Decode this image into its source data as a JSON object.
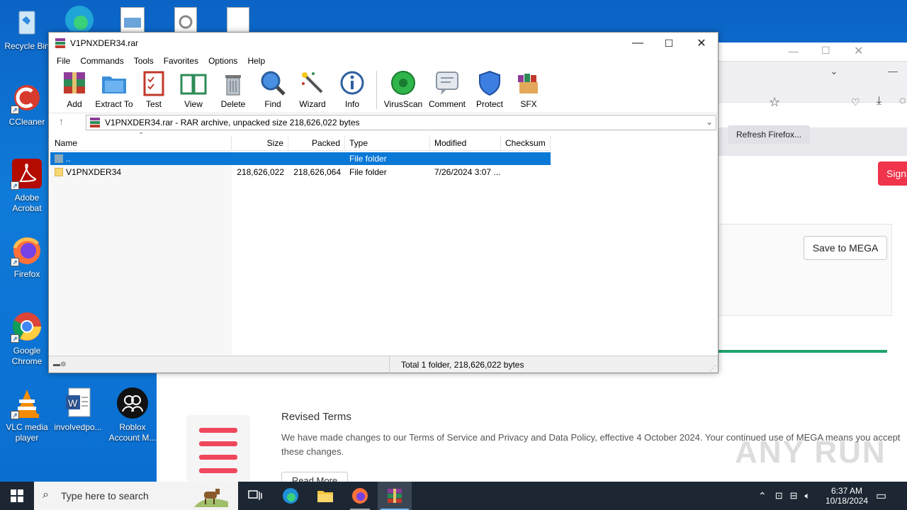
{
  "desktop": {
    "icons": [
      {
        "label": "Recycle Bin"
      },
      {
        "label": "CCleaner"
      },
      {
        "label": "Adobe Acrobat"
      },
      {
        "label": "Firefox"
      },
      {
        "label": "Google Chrome"
      },
      {
        "label": "VLC media player"
      },
      {
        "label": "involvedpo..."
      },
      {
        "label": "Roblox Account M..."
      }
    ]
  },
  "browser": {
    "refresh_button": "Refresh Firefox...",
    "sign_button": "Sign",
    "save_button": "Save to MEGA",
    "progress": 1.0,
    "accent": "#21a36b"
  },
  "mega": {
    "revised_title": "Revised Terms",
    "revised_text": "We have made changes to our Terms of Service and Privacy and Data Policy, effective 4 October 2024. Your continued use of MEGA means you accept these changes.",
    "read_more": "Read More",
    "watermark": "ANY RUN"
  },
  "winrar": {
    "title": "V1PNXDER34.rar",
    "menu": [
      "File",
      "Commands",
      "Tools",
      "Favorites",
      "Options",
      "Help"
    ],
    "tools": [
      "Add",
      "Extract To",
      "Test",
      "View",
      "Delete",
      "Find",
      "Wizard",
      "Info",
      "VirusScan",
      "Comment",
      "Protect",
      "SFX"
    ],
    "address": "V1PNXDER34.rar - RAR archive, unpacked size 218,626,022 bytes",
    "columns": [
      "Name",
      "Size",
      "Packed",
      "Type",
      "Modified",
      "Checksum"
    ],
    "rows": [
      {
        "name": "..",
        "size": "",
        "packed": "",
        "type": "File folder",
        "modified": "",
        "checksum": ""
      },
      {
        "name": "V1PNXDER34",
        "size": "218,626,022",
        "packed": "218,626,064",
        "type": "File folder",
        "modified": "7/26/2024 3:07 ...",
        "checksum": ""
      }
    ],
    "status": "Total 1 folder, 218,626,022 bytes"
  },
  "taskbar": {
    "search_placeholder": "Type here to search",
    "time": "6:37 AM",
    "date": "10/18/2024"
  }
}
